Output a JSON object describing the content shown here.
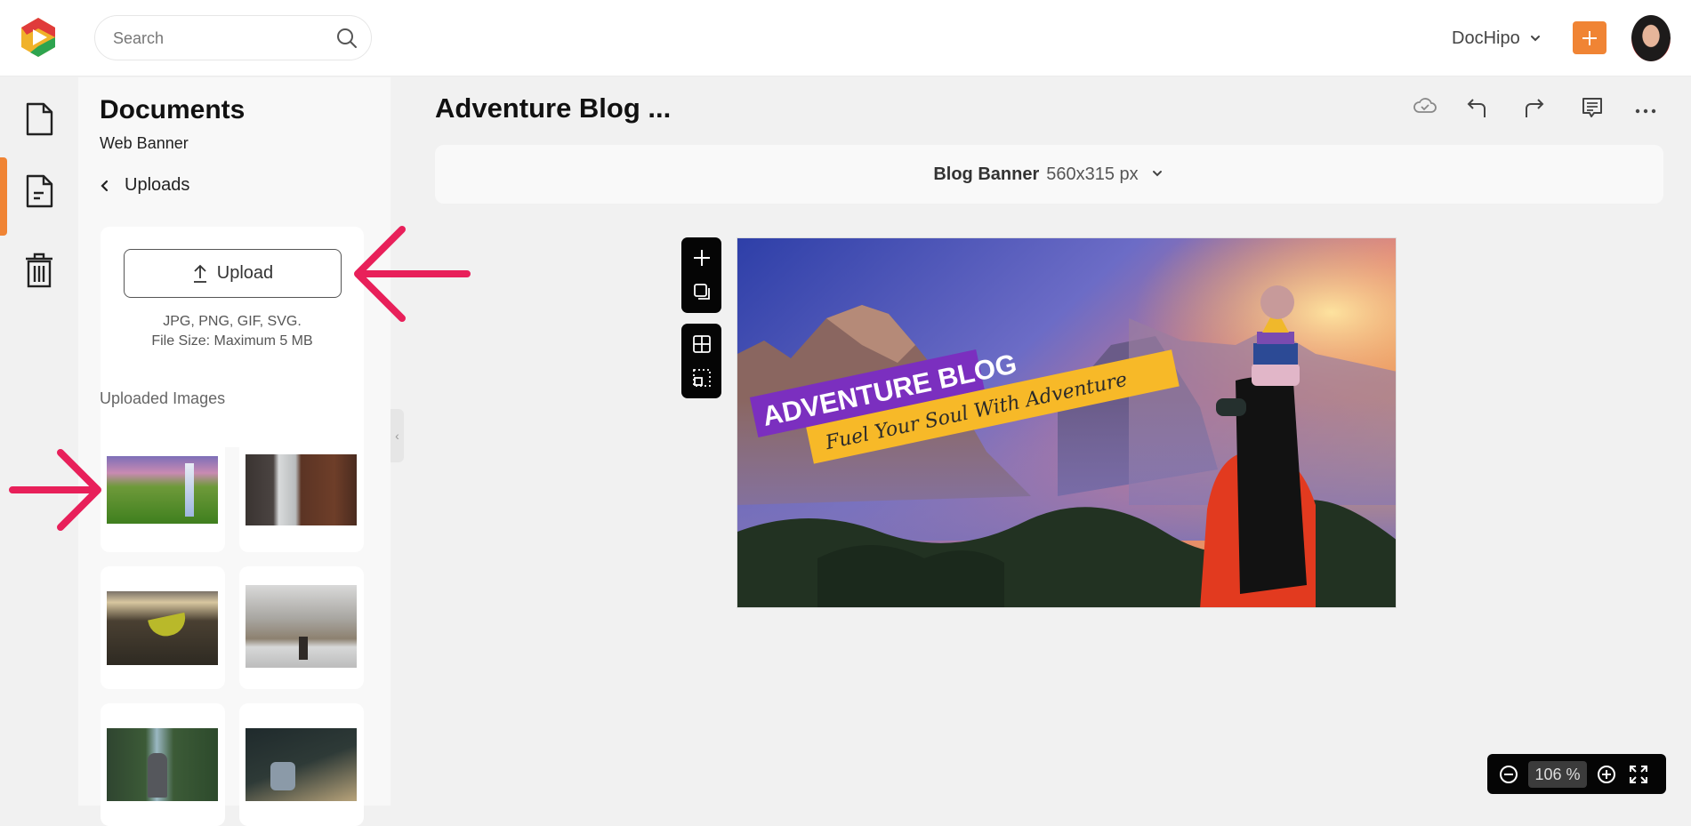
{
  "topbar": {
    "logo": "dochipo-logo",
    "search": {
      "placeholder": "Search",
      "value": ""
    },
    "workspace": "DocHipo",
    "add_button": "plus-icon",
    "avatar": "user-avatar"
  },
  "rail": {
    "items": [
      {
        "name": "documents",
        "icon": "file-icon",
        "active": false
      },
      {
        "name": "document-text",
        "icon": "file-text-icon",
        "active": true
      },
      {
        "name": "trash",
        "icon": "trash-icon",
        "active": false
      }
    ]
  },
  "panel": {
    "title": "Documents",
    "subtitle": "Web Banner",
    "back_label": "Uploads",
    "upload_button": "Upload",
    "upload_formats": "JPG, PNG, GIF, SVG.",
    "upload_size": "File Size: Maximum 5 MB",
    "uploaded_label": "Uploaded Images",
    "images": [
      {
        "name": "waterfall-green-valley"
      },
      {
        "name": "waterfall-rocks"
      },
      {
        "name": "hammock-mountain"
      },
      {
        "name": "hiker-misty-mountain"
      },
      {
        "name": "hiker-forest-road"
      },
      {
        "name": "photographer-crouching"
      }
    ]
  },
  "main": {
    "doc_title": "Adventure Blog ...",
    "toolbar": [
      "cloud-saved-icon",
      "undo-icon",
      "redo-icon",
      "comment-icon",
      "more-icon"
    ],
    "size_name": "Blog Banner",
    "size_dims": "560x315 px",
    "canvas": {
      "headline": "ADVENTURE BLOG",
      "tagline": "Fuel Your Soul With Adventure",
      "headline_bg": "#7b2fbf",
      "tagline_bg": "#f7b928"
    },
    "zoom": "106 %"
  },
  "colors": {
    "accent": "#f08434",
    "annotation": "#e8205a"
  }
}
